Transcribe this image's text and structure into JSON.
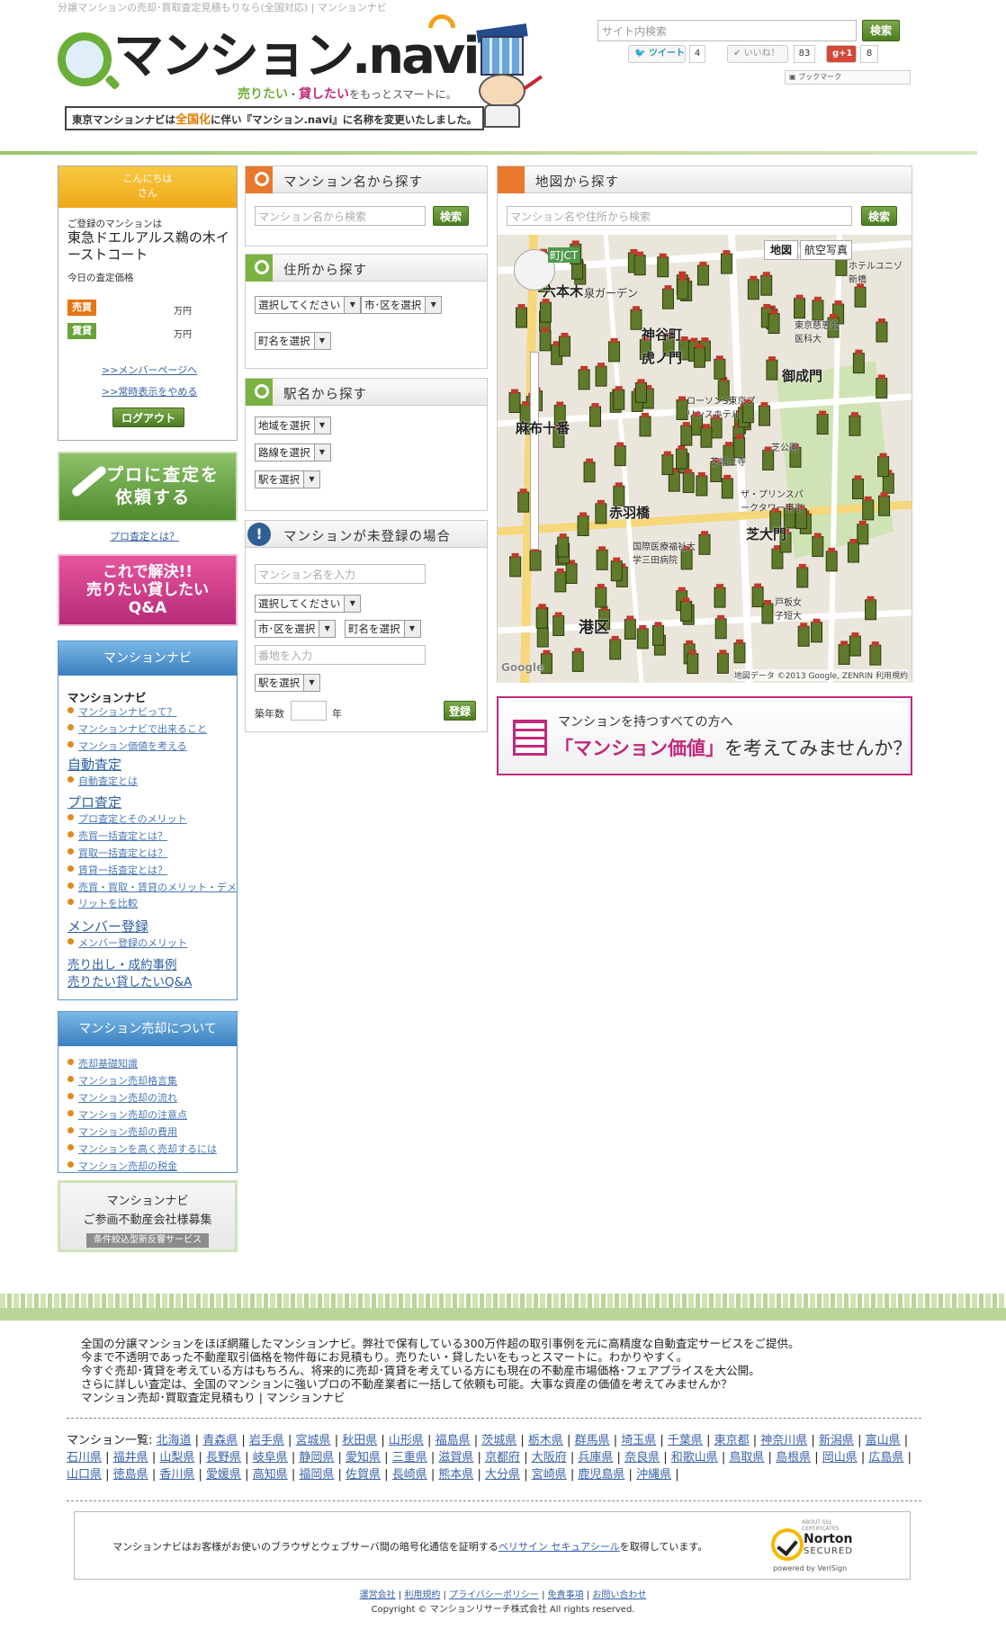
{
  "header": {
    "caption": "分譲マンションの売却･買取査定見積もりなら(全国対応) | マンションナビ",
    "logo_text": "マンション.navi",
    "tagline_pre": "売りたい",
    "tagline_mid": "・",
    "tagline_rent": "貸したい",
    "tagline_post": "をもっとスマートに。",
    "notice_pre": "東京マンションナビは",
    "notice_hl": "全国化",
    "notice_post": "に伴い『マンション.navi』に名称を変更いたしました。",
    "site_search_placeholder": "サイト内検索",
    "site_search_button": "検索",
    "tweet_label": "ツイート",
    "tweet_count": "4",
    "like_label": "いいね！",
    "like_count": "83",
    "gplus_label": "+1",
    "gplus_count": "8",
    "bookmark_label": "ブックマーク"
  },
  "welcome": {
    "greeting_line1": "こんにちは",
    "greeting_line2": "さん",
    "registered_label": "ご登録のマンションは",
    "property_name": "東急ドエルアルス鵜の木イーストコート",
    "today_label": "今日の査定価格",
    "sell_tag": "売買",
    "rent_tag": "賃貸",
    "unit": "万円",
    "member_link": ">>メンバーページへ",
    "hide_link": ">>常時表示をやめる",
    "logout_button": "ログアウト"
  },
  "banners": {
    "pro_line1": "プロに査定を",
    "pro_line2": "依頼する",
    "pro_link": "プロ査定とは？",
    "qa_line1": "これで解決!!",
    "qa_line2": "売りたい貸したい",
    "qa_line3": "Q&A",
    "recruit_line1": "マンションナビ",
    "recruit_line2": "ご参画不動産会社様募集",
    "recruit_line3": "条件絞込型新反響サービス",
    "value_line1": "マンションを持つすべての方へ",
    "value_line2_hl": "「マンション価値」",
    "value_line2_post": "を考えてみませんか？"
  },
  "nav_main": {
    "header": "マンションナビ",
    "sec1_title": "マンションナビ",
    "sec1_items": [
      "マンションナビって？",
      "マンションナビで出来ること",
      "マンション価値を考える"
    ],
    "sec2_title": "自動査定",
    "sec2_items": [
      "自動査定とは"
    ],
    "sec3_title": "プロ査定",
    "sec3_items": [
      "プロ査定とそのメリット",
      "売買一括査定とは？",
      "買取一括査定とは？",
      "賃貸一括査定とは？",
      "売買・買取・賃貸のメリット・デメ",
      "リットを比較"
    ],
    "sec4_title": "メンバー登録",
    "sec4_items": [
      "メンバー登録のメリット"
    ],
    "sec5_title1": "売り出し・成約事例",
    "sec5_title2": "売りたい貸したいQ&A"
  },
  "nav_sale": {
    "header": "マンション売却について",
    "items": [
      "売却基礎知識",
      "マンション売却格言集",
      "マンション売却の流れ",
      "マンション売却の注意点",
      "マンション売却の費用",
      "マンションを高く売却するには",
      "マンション売却の税金"
    ]
  },
  "search_name": {
    "title": "マンション名から探す",
    "placeholder": "マンション名から検索",
    "button": "検索"
  },
  "search_address": {
    "title": "住所から探す",
    "pref_select": "選択してください",
    "city_select": "市･区を選択",
    "town_select": "町名を選択"
  },
  "search_station": {
    "title": "駅名から探す",
    "area_select": "地域を選択",
    "line_select": "路線を選択",
    "station_select": "駅を選択"
  },
  "unregistered": {
    "title": "マンションが未登録の場合",
    "name_placeholder": "マンション名を入力",
    "pref_select": "選択してください",
    "city_select": "市･区を選択",
    "town_select": "町名を選択",
    "address_placeholder": "番地を入力",
    "station_select": "駅を選択",
    "age_label": "築年数",
    "age_unit": "年",
    "register_button": "登録"
  },
  "map": {
    "title": "地図から探す",
    "placeholder": "マンション名や住所から検索",
    "button": "検索",
    "type_map": "地図",
    "type_satellite": "航空写真",
    "labels": [
      "町JCT",
      "六本木",
      "泉ガーデン",
      "神谷町",
      "虎ノ門",
      "御成門",
      "東京慈恵会医科大",
      "ホテルユニゾ新橋",
      "ローソンS東京プリンスホテル",
      "芝公園",
      "芝増上寺",
      "麻布十番",
      "ザ・プリンスパークタワー東京",
      "芝大門",
      "港区",
      "国際医療福祉大学三田病院",
      "赤羽橋",
      "戸板女子短大"
    ],
    "copyright": "地図データ ©2013 Google, ZENRIN  利用規約",
    "google": "Google"
  },
  "footer": {
    "about_lines": [
      "全国の分譲マンションをほぼ網羅したマンションナビ。弊社で保有している300万件超の取引事例を元に高精度な自動査定サービスをご提供。",
      "今まで不透明であった不動産取引価格を物件毎にお見積もり。売りたい・貸したいをもっとスマートに。わかりやすく。",
      "今すぐ売却･賃貸を考えている方はもちろん、将来的に売却･賃貸を考えている方にも現在の不動産市場価格･フェアプライスを大公開。",
      "さらに詳しい査定は、全国のマンションに強いプロの不動産業者に一括して依頼も可能。大事な資産の価値を考えてみませんか？",
      "マンション売却･買取査定見積もり | マンションナビ"
    ],
    "prefs_label": "マンション一覧:",
    "prefs": [
      "北海道",
      "青森県",
      "岩手県",
      "宮城県",
      "秋田県",
      "山形県",
      "福島県",
      "茨城県",
      "栃木県",
      "群馬県",
      "埼玉県",
      "千葉県",
      "東京都",
      "神奈川県",
      "新潟県",
      "富山県",
      "石川県",
      "福井県",
      "山梨県",
      "長野県",
      "岐阜県",
      "静岡県",
      "愛知県",
      "三重県",
      "滋賀県",
      "京都府",
      "大阪府",
      "兵庫県",
      "奈良県",
      "和歌山県",
      "鳥取県",
      "島根県",
      "岡山県",
      "広島県",
      "山口県",
      "徳島県",
      "香川県",
      "愛媛県",
      "高知県",
      "福岡県",
      "佐賀県",
      "長崎県",
      "熊本県",
      "大分県",
      "宮崎県",
      "鹿児島県",
      "沖縄県"
    ],
    "secure_pre": "マンションナビはお客様がお使いのブラウザとウェブサーバ間の暗号化通信を証明する",
    "secure_link": "ベリサイン セキュアシール",
    "secure_post": "を取得しています。",
    "norton_top": "ABOUT SSL CERTIFICATES",
    "norton_name": "Norton",
    "norton_secured": "SECURED",
    "norton_by": "powered by VeriSign",
    "footnav": [
      "運営会社",
      "利用規約",
      "プライバシーポリシー",
      "免責事項",
      "お問い合わせ"
    ],
    "copyright": "Copyright ©  マンションリサーチ株式会社 All rights reserved."
  },
  "colors": {
    "green": "#6cae3a",
    "orange": "#f0a81c",
    "blue": "#3a7fbf",
    "magenta": "#c3287a"
  }
}
